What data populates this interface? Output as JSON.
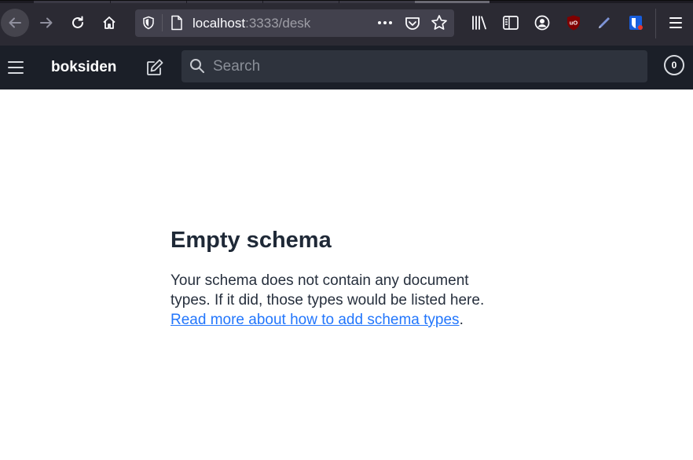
{
  "browser": {
    "url_host": "localhost",
    "url_path": ":3333/desk",
    "icons": {
      "back": "arrow-left-icon",
      "forward": "arrow-right-icon",
      "reload": "reload-icon",
      "home": "home-icon",
      "tracking": "shield-icon",
      "page": "page-icon",
      "more": "more-dots-icon",
      "pocket": "pocket-icon",
      "bookmark": "star-icon",
      "library": "library-icon",
      "sidebar": "sidebar-icon",
      "account": "account-icon",
      "ublock": "ublock-icon",
      "pen_tool": "pen-icon",
      "bitwarden": "bitwarden-icon",
      "menu": "hamburger-icon"
    }
  },
  "app": {
    "brand": "boksiden",
    "search_placeholder": "Search",
    "notification_count": "0",
    "colors": {
      "header_bg": "#1b1f28",
      "search_bg": "#2e333d",
      "link": "#2276fc",
      "title": "#1f2937"
    }
  },
  "main": {
    "title": "Empty schema",
    "description": "Your schema does not contain any document types. If it did, those types would be listed here.",
    "link_text": "Read more about how to add schema types",
    "trailing": "."
  }
}
